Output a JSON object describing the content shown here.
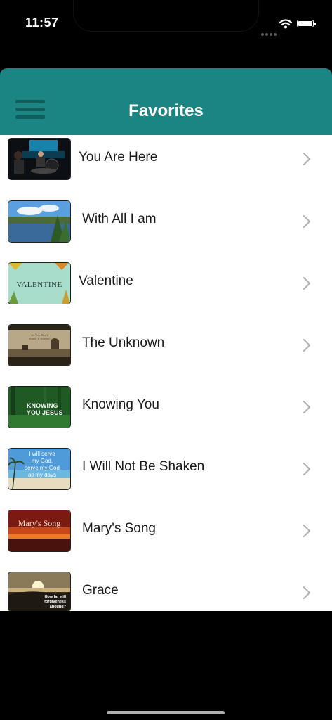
{
  "status_bar": {
    "time": "11:57"
  },
  "header": {
    "title": "Favorites",
    "menu_icon": "hamburger-menu-icon"
  },
  "colors": {
    "header_bg": "#1a8582",
    "list_bg": "#ffffff",
    "chevron": "#b3b3b3"
  },
  "favorites": [
    {
      "title": "You Are Here",
      "thumbnail": "worship-band-thumbnail"
    },
    {
      "title": "With All I am",
      "thumbnail": "lake-landscape-thumbnail"
    },
    {
      "title": "Valentine",
      "thumbnail": "valentine-banner-thumbnail",
      "thumb_text": "VALENTINE"
    },
    {
      "title": "The Unknown",
      "thumbnail": "sepia-field-thumbnail",
      "thumb_text": "As You Don't\nKnow It Known"
    },
    {
      "title": "Knowing You",
      "thumbnail": "green-forest-thumbnail",
      "thumb_text": "KNOWING\nYOU JESUS"
    },
    {
      "title": "I Will Not Be Shaken",
      "thumbnail": "beach-lyrics-thumbnail",
      "thumb_text": "I will serve\nmy God,\nserve my God\nall my days"
    },
    {
      "title": "Mary's Song",
      "thumbnail": "red-sunset-thumbnail",
      "thumb_text": "Mary's Song"
    },
    {
      "title": "Grace",
      "thumbnail": "sunset-hills-thumbnail",
      "thumb_text": "How far will\nforgiveness\nabound?"
    }
  ]
}
